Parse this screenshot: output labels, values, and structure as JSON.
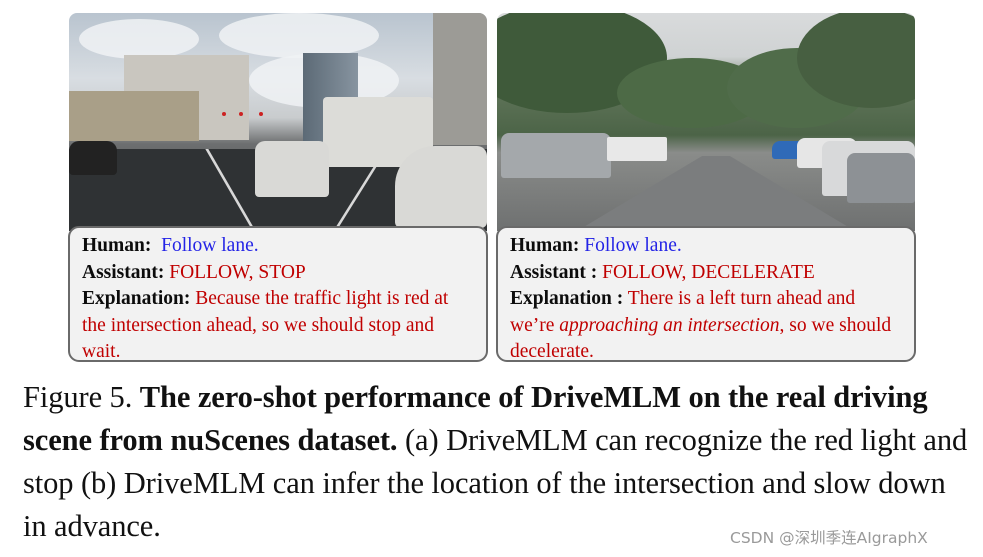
{
  "figure": {
    "panels": [
      {
        "id": "a",
        "scene_description": "Urban multi-lane road approaching an intersection with red traffic lights, white sedan ahead, city bus on the right, buildings and cloudy sky",
        "dialog": {
          "human_label": "Human:",
          "human_text": "Follow lane.",
          "assistant_label": "Assistant:",
          "assistant_text": "FOLLOW, STOP",
          "explanation_label": "Explanation:",
          "explanation_text": "Because the traffic light is red at the intersection ahead, so we should stop and wait."
        }
      },
      {
        "id": "b",
        "scene_description": "Tree-lined road with parked cars on both sides, road curving left ahead",
        "dialog": {
          "human_label": "Human:",
          "human_text": "Follow lane.",
          "assistant_label": "Assistant :",
          "assistant_text": "FOLLOW, DECELERATE",
          "explanation_label": "Explanation :",
          "explanation_pre": "There is a left turn ahead and we’re ",
          "explanation_italic": "approaching an intersection",
          "explanation_post": ", so we should decelerate."
        }
      }
    ],
    "caption": {
      "prefix": "Figure 5. ",
      "bold": "The zero-shot performance of DriveMLM on the real driving scene from nuScenes dataset.",
      "rest": " (a) DriveMLM can recognize the red light and stop (b) DriveMLM can infer the location of the intersection and slow down in advance."
    },
    "watermark": "CSDN @深圳季连AIgraphX",
    "colors": {
      "human_text": "#2323e6",
      "assistant_text": "#c00000",
      "box_fill": "#f2f2f2",
      "box_border": "#6a6a6a"
    }
  }
}
